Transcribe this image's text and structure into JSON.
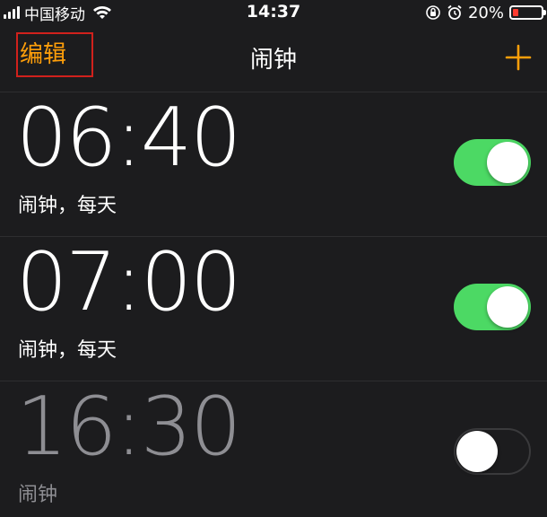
{
  "status_bar": {
    "carrier": "中国移动",
    "time": "14:37",
    "battery_percent": "20%",
    "battery_level": 0.2,
    "icons": [
      "signal-icon",
      "wifi-icon",
      "orientation-lock-icon",
      "alarm-icon",
      "battery-icon"
    ]
  },
  "nav": {
    "edit_label": "编辑",
    "title": "闹钟",
    "add_icon": "plus-icon"
  },
  "alarms": [
    {
      "time": "06:40",
      "label": "闹钟，每天",
      "enabled": true
    },
    {
      "time": "07:00",
      "label": "闹钟，每天",
      "enabled": true
    },
    {
      "time": "16:30",
      "label": "闹钟",
      "enabled": false
    }
  ],
  "colors": {
    "accent": "#ff9f0a",
    "toggle_on": "#4cd964",
    "background": "#1c1c1e",
    "highlight_box": "#d0211c",
    "battery_low": "#ff3b30"
  }
}
